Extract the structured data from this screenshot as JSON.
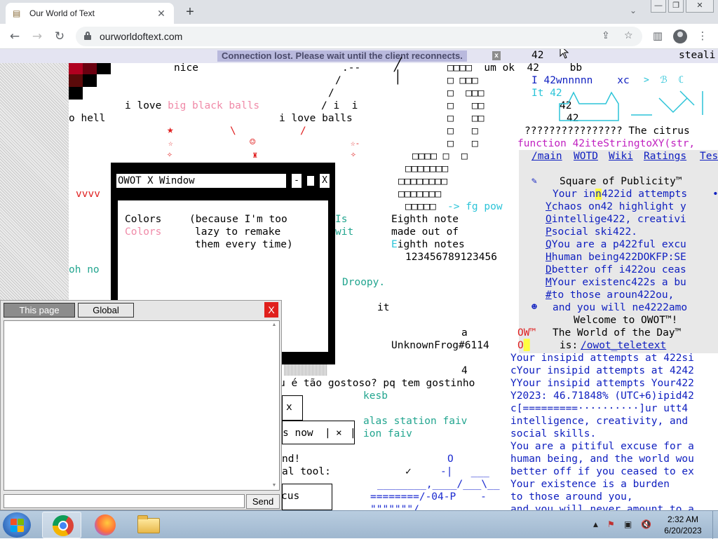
{
  "browser": {
    "tab_title": "Our World of Text",
    "tab_close": "✕",
    "new_tab": "+",
    "url": "ourworldoftext.com",
    "window_controls": [
      "—",
      "❐",
      "✕"
    ],
    "nav": {
      "back": "←",
      "forward": "→",
      "reload": "↻"
    },
    "icons": {
      "share": "share-icon",
      "star": "star-icon",
      "sidebar": "side-panel-icon",
      "profile": "profile-icon",
      "menu": "kebab-menu-icon"
    }
  },
  "banner": {
    "message": "Connection lost. Please wait until the client reconnects.",
    "close": "x"
  },
  "world_text": {
    "nice": "nice",
    "dash_a": ".--",
    "slash_a": "/",
    "slash_b": "/",
    "i_love_big": "i love ",
    "big_black_balls": "big black balls",
    "slash_i_i": "/ i  i",
    "o_hell": "o hell",
    "i_love_balls": "i love balls",
    "bslash": "\\",
    "fslash": "/",
    "vvvv": "vvvv",
    "oh_no": "oh no",
    "is": "Is",
    "wit": "wit",
    "droopy": "Droopy.",
    "it": "it",
    "a": "a",
    "unknownfrog": "UnknownFrog#6114",
    "four": "4",
    "portuguese": "u é tão gostoso? pq tem gostinho",
    "kesb": "kesb",
    "alas": "alas station faiv",
    "ion_faiv": "ion faiv",
    "nd": "nd!",
    "al_tool": "al tool:",
    "cus": "cus",
    "tab_x": "x",
    "s_now": "s now",
    "small_x": "×",
    "eighth_1": "Eighth note",
    "eighth_2": "made out of",
    "eighth_3a": "E",
    "eighth_3b": "ighth notes",
    "digits": "123456789123456",
    "grid_rows": [
      "□□□□  um ok  42     bb",
      "□ □□□",
      "□  □□□",
      "□   □□",
      "□   □□",
      "□   □",
      "□   □",
      "□□□□ □  □",
      "□□□□□□□",
      "□□□□□□□□",
      "□□□□□□□",
      "□□□□□"
    ],
    "fg_pow": "-> fg pow",
    "o_letter": "O",
    "check": "✓",
    "art_1": "-|   ___",
    "art_2": "________,____/___\\__",
    "art_3": "========/-04-P    -",
    "art_4": "\"\"\"\"\"\"\"/"
  },
  "right_panel": {
    "top_42": "42",
    "steal": "steali",
    "r1": "I 42wnnnnn    xc",
    "r2": "It 42",
    "r3": "42",
    "r4": "42",
    "citrus": "???????????????? The citrus",
    "function": "function 42iteStringtoXY(str,",
    "links": [
      "/main",
      "WOTD",
      "Wiki",
      "Ratings",
      "Tes"
    ],
    "square": "Square of Publicity™",
    "lines": [
      {
        "first": "",
        "rest": "Your in",
        "hl": "n",
        "tail": "422id attempts"
      },
      {
        "first": "Y",
        "rest": "chaos on42 highlight y"
      },
      {
        "first": "O",
        "rest": "intellige422, creativi"
      },
      {
        "first": "P",
        "rest": "social ski422."
      },
      {
        "first": "Q",
        "rest": "You are a p422ful excu"
      },
      {
        "first": "H",
        "rest": "human being422DOKFP:SE"
      },
      {
        "first": "D",
        "rest": "better off i422ou ceas"
      },
      {
        "first": "M",
        "rest": "Your existenc422s a bu"
      },
      {
        "first": "#",
        "rest": "to those aroun422ou,"
      },
      {
        "first": "",
        "rest": "and you will ne4222amo"
      }
    ],
    "welcome": "Welcome to OWOT™!",
    "ow": "OW™",
    "o2": "O",
    "wotd": "The World of the Day™",
    "is": "is:",
    "wotd_link": "/owot_teletext",
    "bottom": [
      "Your insipid attempts at 422si",
      "cYour insipid attempts at 4242",
      "YYour insipid attempts Your422",
      "Y2023: 46.71848% (UTC+6)ipid42",
      "c[=========··········]ur utt4",
      "intelligence, creativity, and",
      "social skills.",
      "You are a pitiful excuse for a",
      "human being, and the world wou",
      "better off if you ceased to ex",
      "Your existence is a burden",
      "to those around you,",
      "and you will never amount to a"
    ]
  },
  "owot_window": {
    "title": "OWOT X Window",
    "btn_min": "-",
    "btn_close": "X",
    "line1_a": "Colors",
    "line1_b": "(because I'm too",
    "line2_a": "Colors",
    "line2_b": "lazy to remake",
    "line3": "them every time)"
  },
  "chat": {
    "tab_this_page": "This page",
    "tab_global": "Global",
    "close": "X",
    "input_value": "",
    "send": "Send"
  },
  "taskbar": {
    "time": "2:32 AM",
    "date": "6/20/2023",
    "apps": [
      "chrome-icon",
      "firefox-icon",
      "file-explorer-icon"
    ],
    "tray_arrow": "▲"
  }
}
